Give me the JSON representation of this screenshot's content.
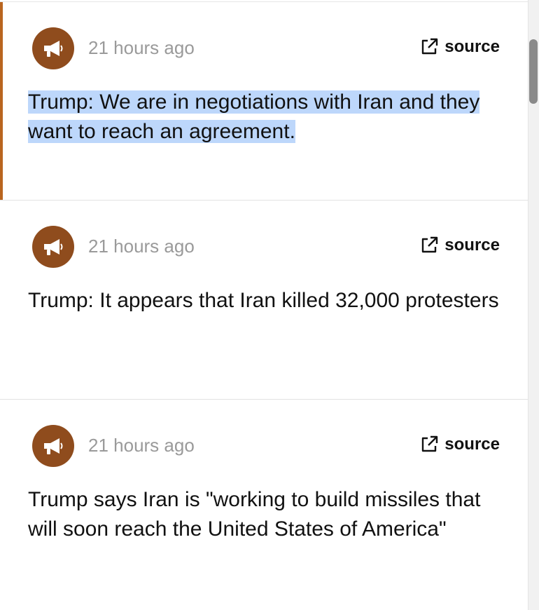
{
  "feed": {
    "items": [
      {
        "time": "21 hours ago",
        "source_label": "source",
        "text": "Trump: We are in negotiations with Iran and they want to reach an agreement.",
        "highlighted": true
      },
      {
        "time": "21 hours ago",
        "source_label": "source",
        "text": "Trump: It appears that Iran killed 32,000 protesters",
        "highlighted": false
      },
      {
        "time": "21 hours ago",
        "source_label": "source",
        "text": "Trump says Iran is \"working to build missiles that will soon reach the United States of America\"",
        "highlighted": false
      }
    ]
  },
  "colors": {
    "accent": "#b9651f",
    "avatar_bg": "#8f4c1d",
    "selection": "#bdd7fb",
    "timestamp": "#9a9a9a"
  },
  "icons": {
    "avatar": "megaphone-icon",
    "source": "external-link-icon"
  }
}
